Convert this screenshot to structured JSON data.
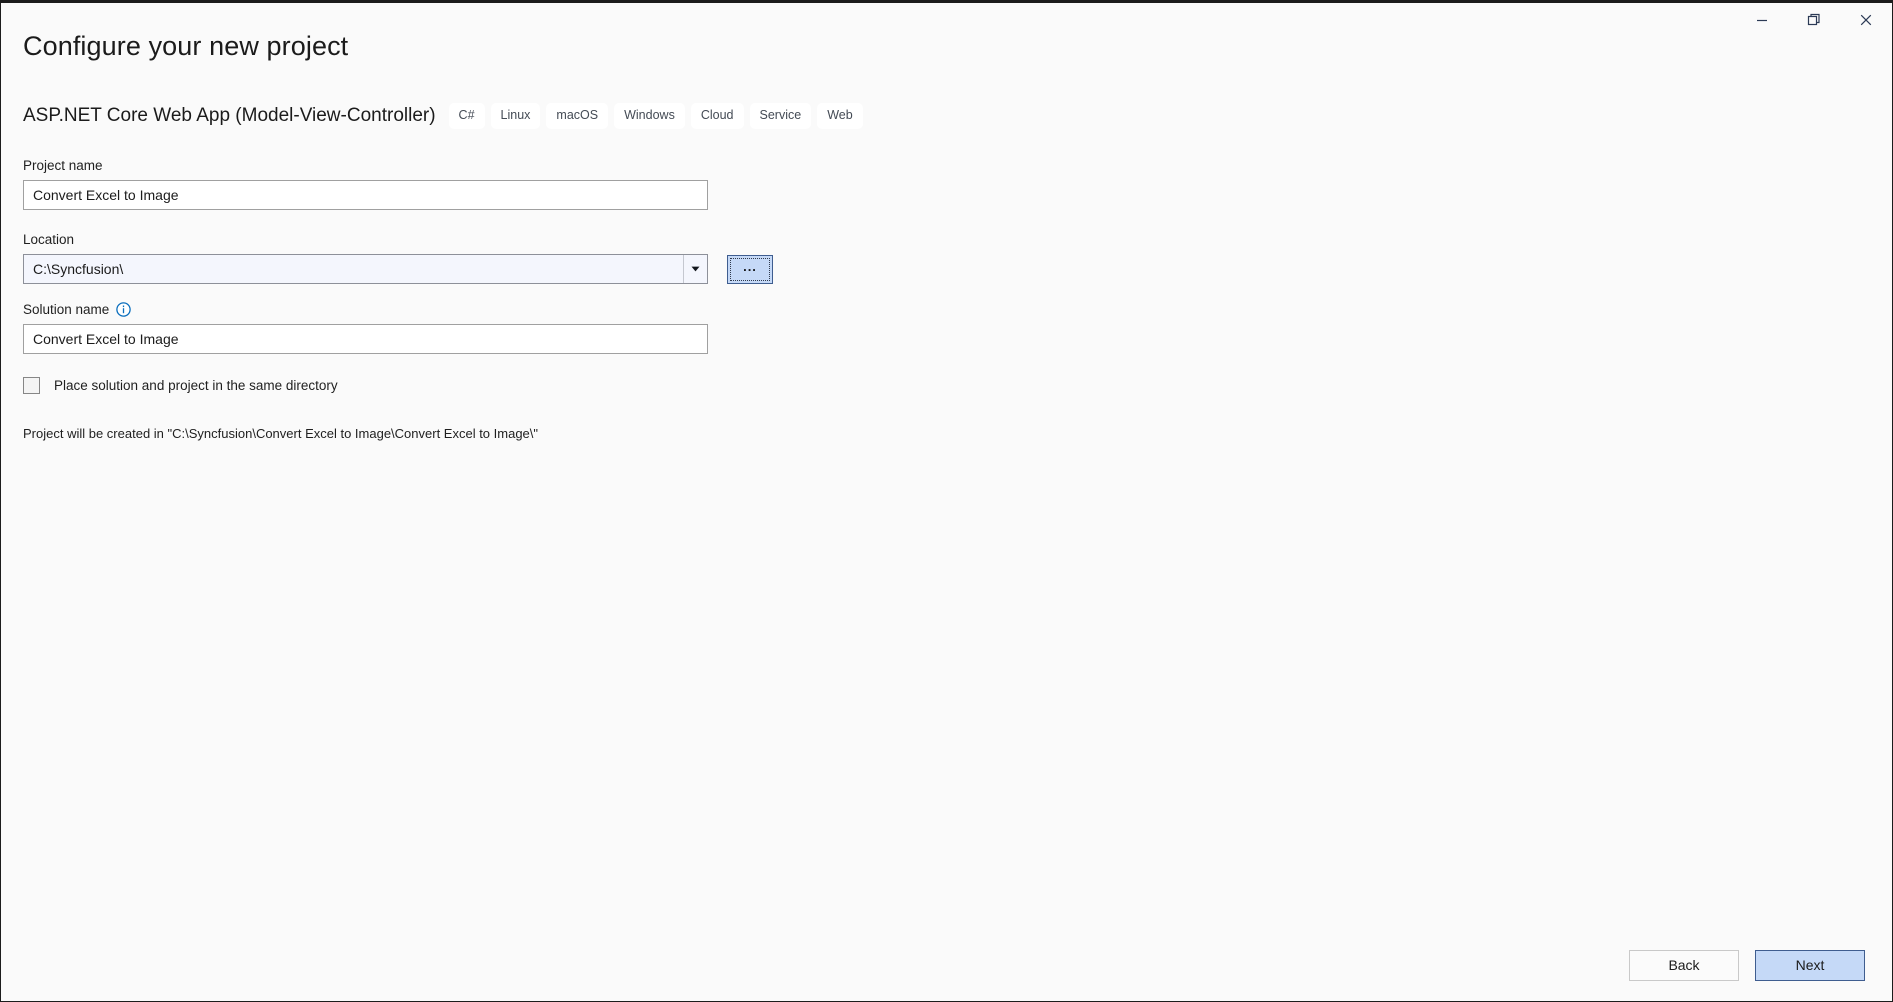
{
  "window": {
    "controls": [
      {
        "name": "minimize",
        "glyph": "minimize-icon"
      },
      {
        "name": "restore",
        "glyph": "restore-icon"
      },
      {
        "name": "close",
        "glyph": "close-icon"
      }
    ]
  },
  "header": {
    "title": "Configure your new project",
    "template_name": "ASP.NET Core Web App (Model-View-Controller)",
    "tags": [
      "C#",
      "Linux",
      "macOS",
      "Windows",
      "Cloud",
      "Service",
      "Web"
    ]
  },
  "form": {
    "project_name": {
      "label": "Project name",
      "value": "Convert Excel to Image",
      "placeholder": "Project name"
    },
    "location": {
      "label": "Location",
      "value": "C:\\Syncfusion\\",
      "placeholder": "Location",
      "browse_label": "...",
      "dropdown_icon": "chevron-down-icon"
    },
    "solution_name": {
      "label": "Solution name",
      "info_icon": "info-icon",
      "value": "Convert Excel to Image",
      "placeholder": "Solution name"
    },
    "same_directory_checkbox": {
      "label": "Place solution and project in the same directory",
      "checked": false
    },
    "created_in_text": "Project will be created in \"C:\\Syncfusion\\Convert Excel to Image\\Convert Excel to Image\\\""
  },
  "footer": {
    "back_label": "Back",
    "next_label": "Next"
  },
  "colors": {
    "page_background": "#fafafa",
    "accent_button": "#c5d9f7",
    "accent_border": "#3f5d8f",
    "combo_background": "#f4f6fd",
    "info_icon": "#0a6ebd",
    "text": "#1b1b1b"
  }
}
